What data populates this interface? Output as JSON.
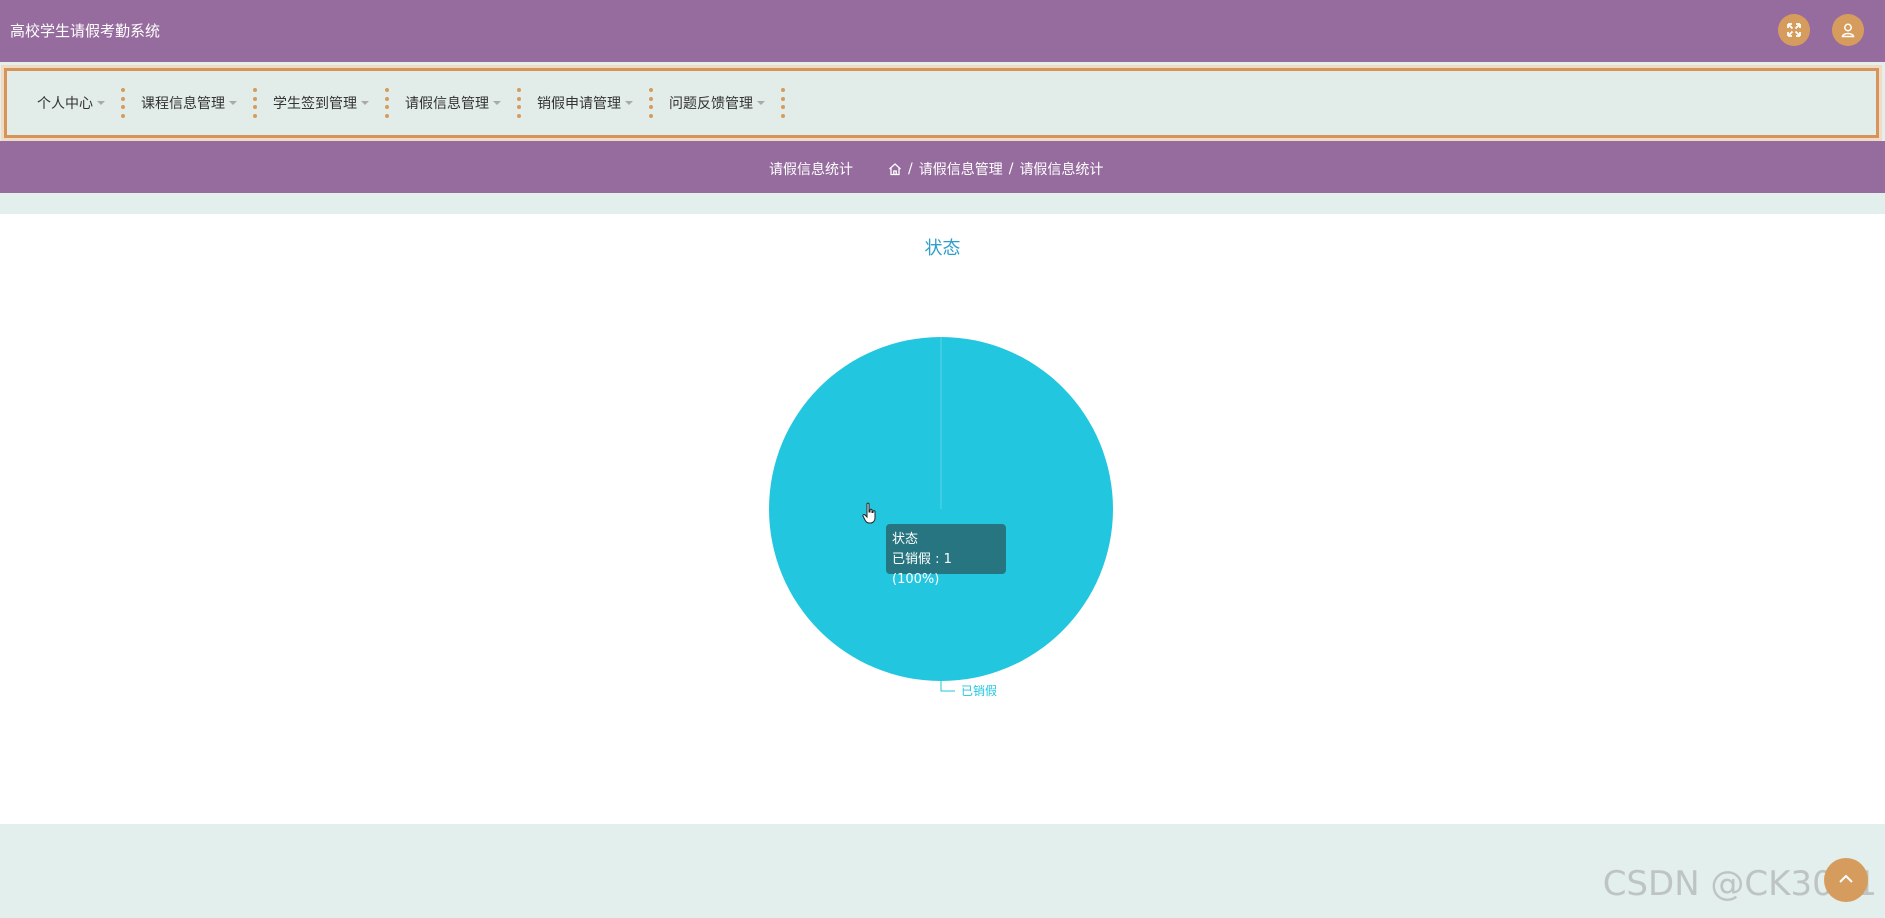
{
  "header": {
    "app_title": "高校学生请假考勤系统",
    "fullscreen_icon": "fullscreen-icon",
    "user_icon": "user-icon"
  },
  "nav": {
    "items": [
      {
        "label": "个人中心"
      },
      {
        "label": "课程信息管理"
      },
      {
        "label": "学生签到管理"
      },
      {
        "label": "请假信息管理"
      },
      {
        "label": "销假申请管理"
      },
      {
        "label": "问题反馈管理"
      }
    ]
  },
  "breadcrumb": {
    "page_title": "请假信息统计",
    "home_icon": "home-icon",
    "path": [
      "请假信息管理",
      "请假信息统计"
    ],
    "separator": "/"
  },
  "colors": {
    "header_bg": "#966c9e",
    "accent_orange": "#d69c5e",
    "nav_bg": "#e2ece8",
    "pie_color": "#22c6de",
    "title_color": "#2f9fc9"
  },
  "chart_data": {
    "type": "pie",
    "title": "状态",
    "slices": [
      {
        "label": "已销假",
        "value": 1,
        "percent": 100
      }
    ],
    "tooltip": {
      "title": "状态",
      "line": "已销假 : 1 (100%)"
    }
  },
  "watermark": "CSDN @CK3041"
}
